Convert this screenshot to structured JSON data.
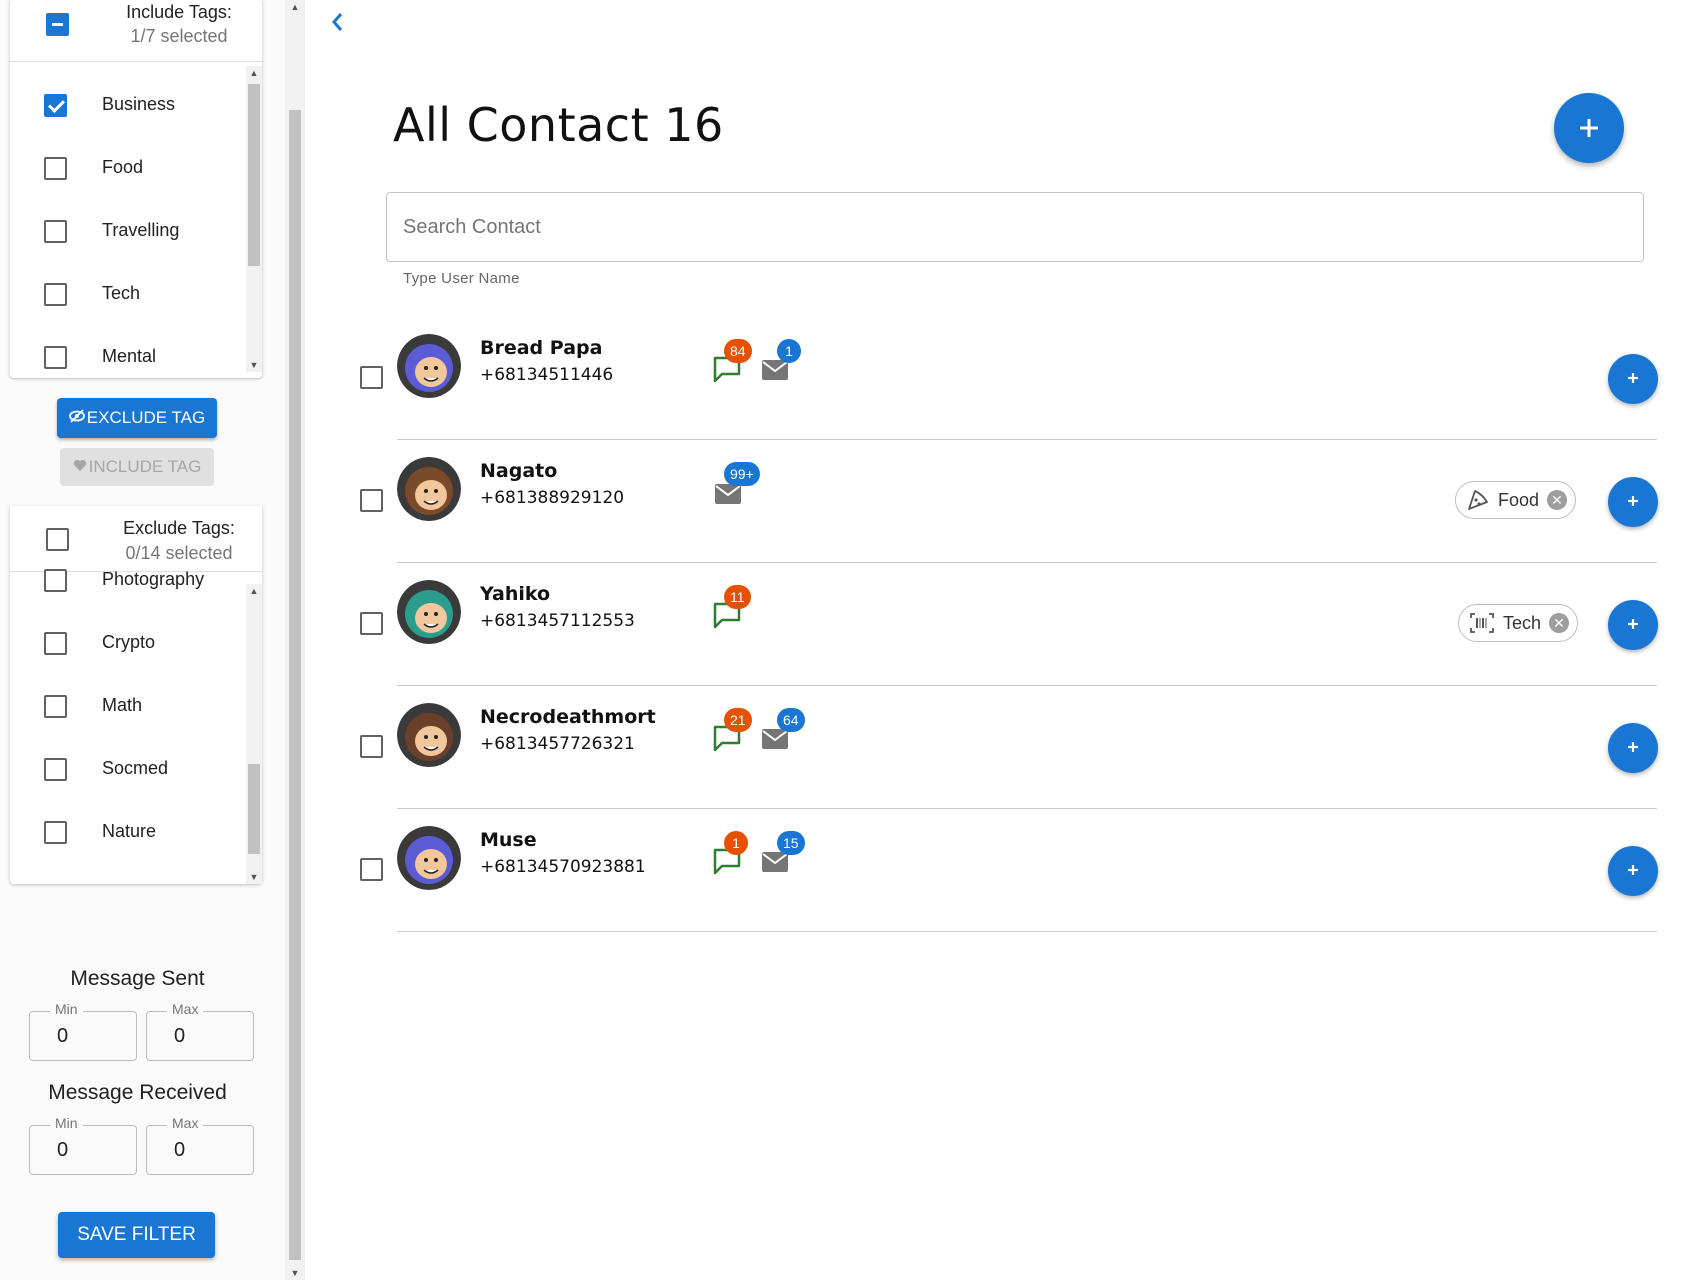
{
  "include_tags": {
    "title": "Include Tags:",
    "subtitle": "1/7 selected",
    "items": [
      {
        "label": "Business",
        "checked": true
      },
      {
        "label": "Food",
        "checked": false
      },
      {
        "label": "Travelling",
        "checked": false
      },
      {
        "label": "Tech",
        "checked": false
      },
      {
        "label": "Mental",
        "checked": false
      }
    ]
  },
  "buttons": {
    "exclude_tag": "EXCLUDE TAG",
    "include_tag": "INCLUDE TAG",
    "save_filter": "SAVE FILTER"
  },
  "exclude_tags": {
    "title": "Exclude Tags:",
    "subtitle": "0/14 selected",
    "items": [
      {
        "label": "Photography",
        "checked": false
      },
      {
        "label": "Crypto",
        "checked": false
      },
      {
        "label": "Math",
        "checked": false
      },
      {
        "label": "Socmed",
        "checked": false
      },
      {
        "label": "Nature",
        "checked": false
      }
    ]
  },
  "message_sent": {
    "title": "Message Sent",
    "min_label": "Min",
    "min_value": "0",
    "max_label": "Max",
    "max_value": "0"
  },
  "message_received": {
    "title": "Message Received",
    "min_label": "Min",
    "min_value": "0",
    "max_label": "Max",
    "max_value": "0"
  },
  "main": {
    "title": "All Contact 16",
    "search_placeholder": "Search Contact",
    "search_helper": "Type User Name"
  },
  "contacts": [
    {
      "name": "Bread Papa",
      "phone": "+68134511446",
      "chat_badge": "84",
      "mail_badge": "1",
      "tag": "",
      "avatar_color": "#5b5bd6"
    },
    {
      "name": "Nagato",
      "phone": "+681388929120",
      "chat_badge": "",
      "mail_badge": "99+",
      "tag": "Food",
      "avatar_color": "#7a4a2a"
    },
    {
      "name": "Yahiko",
      "phone": "+6813457112553",
      "chat_badge": "11",
      "mail_badge": "",
      "tag": "Tech",
      "avatar_color": "#2a9d8f"
    },
    {
      "name": "Necrodeathmort",
      "phone": "+6813457726321",
      "chat_badge": "21",
      "mail_badge": "64",
      "tag": "",
      "avatar_color": "#6b3f2a"
    },
    {
      "name": "Muse",
      "phone": "+68134570923881",
      "chat_badge": "1",
      "mail_badge": "15",
      "tag": "",
      "avatar_color": "#5b5bd6"
    }
  ],
  "colors": {
    "primary": "#1976d2",
    "badge_orange": "#e65100",
    "chat_icon": "#2e7d32",
    "mail_icon": "#757575"
  }
}
